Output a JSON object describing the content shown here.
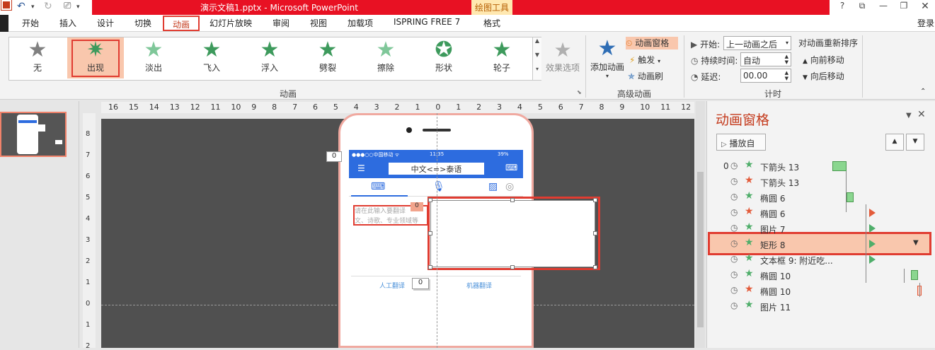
{
  "window": {
    "title": "演示文稿1.pptx -  Microsoft PowerPoint",
    "context_tools": "绘图工具",
    "help": "?",
    "sign_in": "登录"
  },
  "tabs": [
    {
      "label": "开始"
    },
    {
      "label": "插入"
    },
    {
      "label": "设计"
    },
    {
      "label": "切换"
    },
    {
      "label": "动画"
    },
    {
      "label": "幻灯片放映"
    },
    {
      "label": "审阅"
    },
    {
      "label": "视图"
    },
    {
      "label": "加载项"
    },
    {
      "label": "ISPRING FREE 7"
    },
    {
      "label": "格式"
    }
  ],
  "gallery": {
    "items": [
      {
        "label": "无",
        "color": "#777777"
      },
      {
        "label": "出现",
        "color": "#3d9a5c"
      },
      {
        "label": "淡出",
        "color": "#6bbf8a"
      },
      {
        "label": "飞入",
        "color": "#3d9a5c"
      },
      {
        "label": "浮入",
        "color": "#3d9a5c"
      },
      {
        "label": "劈裂",
        "color": "#3d9a5c"
      },
      {
        "label": "擦除",
        "color": "#6bbf8a"
      },
      {
        "label": "形状",
        "color": "#3d9a5c"
      },
      {
        "label": "轮子",
        "color": "#3d9a5c"
      }
    ],
    "effect_options": "效果选项",
    "group_label": "动画"
  },
  "advanced": {
    "add_animation": "添加动画",
    "animation_pane": "动画窗格",
    "trigger": "触发",
    "painter": "动画刷",
    "group_label": "高级动画"
  },
  "timing": {
    "start_label": "开始:",
    "start_value": "上一动画之后",
    "duration_label": "持续时间:",
    "duration_value": "自动",
    "delay_label": "延迟:",
    "delay_value": "00.00",
    "reorder_title": "对动画重新排序",
    "move_earlier": "向前移动",
    "move_later": "向后移动",
    "group_label": "计时"
  },
  "ruler": {
    "h_ticks": [
      "16",
      "15",
      "14",
      "13",
      "12",
      "11",
      "10",
      "9",
      "8",
      "7",
      "6",
      "5",
      "4",
      "3",
      "2",
      "1",
      "0",
      "1",
      "2",
      "3",
      "4",
      "5",
      "6",
      "7",
      "8",
      "9",
      "10",
      "11",
      "12"
    ],
    "v_ticks": [
      "8",
      "7",
      "6",
      "5",
      "4",
      "3",
      "2",
      "1",
      "0",
      "1",
      "2"
    ]
  },
  "slide": {
    "badge_0": "0",
    "phone_carrier": "●●●○○中国移动 ᯤ",
    "phone_time": "11:35",
    "phone_battery": "39%",
    "phone_title": "中文<=>泰语",
    "input_placeholder_1": "请在此输入要翻译",
    "input_placeholder_2": "文、诗歌、专业领域等",
    "input_badge": "0",
    "human_translate": "人工翻译",
    "machine_translate": "机器翻译",
    "human_badge": "0"
  },
  "pane": {
    "title": "动画窗格",
    "play_from": "播放自",
    "items": [
      {
        "order": "0",
        "name": "下箭头 13",
        "star": "green",
        "bar": "green"
      },
      {
        "order": "",
        "name": "下箭头 13",
        "star": "red",
        "bar": "none"
      },
      {
        "order": "",
        "name": "椭圆 6",
        "star": "green",
        "bar": "green"
      },
      {
        "order": "",
        "name": "椭圆 6",
        "star": "red",
        "bar": "red-tri"
      },
      {
        "order": "",
        "name": "图片 7",
        "star": "green",
        "bar": "green-tri"
      },
      {
        "order": "",
        "name": "矩形 8",
        "star": "green",
        "bar": "green-tri"
      },
      {
        "order": "",
        "name": "文本框 9: 附近吃...",
        "star": "green",
        "bar": "green-tri"
      },
      {
        "order": "",
        "name": "椭圆 10",
        "star": "green",
        "bar": "green"
      },
      {
        "order": "",
        "name": "椭圆 10",
        "star": "red",
        "bar": "red"
      },
      {
        "order": "",
        "name": "图片 11",
        "star": "green",
        "bar": "none"
      }
    ]
  },
  "colors": {
    "accent_red": "#e03c31",
    "title_red": "#e81123",
    "selection": "#f9c7ad",
    "green": "#4fae6a"
  }
}
